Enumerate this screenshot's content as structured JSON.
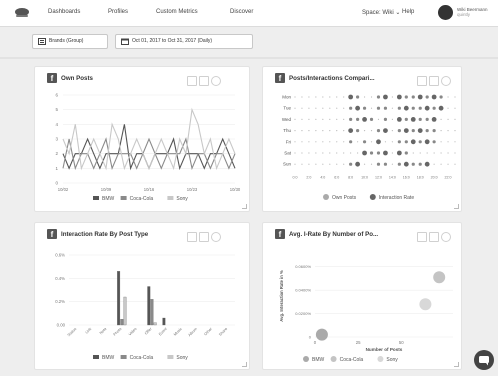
{
  "nav": {
    "items": [
      "Dashboards",
      "Profiles",
      "Custom Metrics",
      "Discover"
    ],
    "space": "Space: Wiki",
    "help": "Help",
    "user_name": "Wiki Beermann",
    "user_sub": "quintly"
  },
  "filters": {
    "profiles_label": "Brands (Group)",
    "date_label": "Oct 01, 2017 to Oct 31, 2017 (Daily)"
  },
  "cards": {
    "own_posts": {
      "title": "Own Posts",
      "legend": [
        "BMW",
        "Coca-Cola",
        "Sony"
      ]
    },
    "posts_interactions": {
      "title": "Posts/Interactions Compari...",
      "legend": [
        "Own Posts",
        "Interaction Rate"
      ]
    },
    "interaction_rate": {
      "title": "Interaction Rate By Post Type",
      "legend": [
        "BMW",
        "Coca-Cola",
        "Sony"
      ]
    },
    "avg_irate": {
      "title": "Avg. I-Rate By Number of Po...",
      "legend": [
        "BMW",
        "Coca-Cola",
        "Sony"
      ]
    }
  },
  "colors": {
    "bmw": "#555555",
    "cocacola": "#8a8a8a",
    "sony": "#c8c8c8"
  },
  "chart_data": [
    {
      "type": "line",
      "title": "Own Posts",
      "x": [
        "10/02",
        "10/03",
        "10/04",
        "10/05",
        "10/06",
        "10/07",
        "10/08",
        "10/09",
        "10/10",
        "10/11",
        "10/12",
        "10/13",
        "10/14",
        "10/15",
        "10/16",
        "10/17",
        "10/18",
        "10/19",
        "10/20",
        "10/21",
        "10/22",
        "10/23",
        "10/24",
        "10/25",
        "10/26",
        "10/27",
        "10/28",
        "10/29",
        "10/30"
      ],
      "x_tick_labels": [
        "10/02",
        "10/09",
        "10/16",
        "10/23",
        "10/30"
      ],
      "ylim": [
        0,
        6
      ],
      "y_ticks": [
        0,
        1,
        2,
        3,
        4,
        5,
        6
      ],
      "series": [
        {
          "name": "BMW",
          "values": [
            2,
            1,
            2,
            2,
            3,
            2,
            1,
            2,
            2,
            2,
            4,
            1,
            2,
            2,
            1,
            2,
            2,
            2,
            3,
            1,
            2,
            2,
            2,
            1,
            2,
            2,
            3,
            2,
            1
          ]
        },
        {
          "name": "Coca-Cola",
          "values": [
            1,
            3,
            1,
            2,
            2,
            1,
            2,
            3,
            1,
            2,
            2,
            2,
            1,
            2,
            3,
            2,
            1,
            2,
            2,
            2,
            3,
            1,
            2,
            2,
            1,
            2,
            2,
            1,
            2
          ]
        },
        {
          "name": "Sony",
          "values": [
            3,
            2,
            4,
            1,
            2,
            3,
            2,
            1,
            4,
            3,
            1,
            2,
            3,
            2,
            1,
            2,
            3,
            2,
            1,
            3,
            2,
            5,
            4,
            2,
            3,
            1,
            2,
            3,
            2
          ]
        }
      ]
    },
    {
      "type": "scatter",
      "title": "Posts/Interactions Comparison",
      "categories": [
        "Mon",
        "Tue",
        "Wed",
        "Thu",
        "Fri",
        "Sat",
        "Sun"
      ],
      "x_tick_labels": [
        "0:0",
        "2:0",
        "4:0",
        "6:0",
        "8:0",
        "10:0",
        "12:0",
        "14:0",
        "16:0",
        "18:0",
        "20:0",
        "22:0"
      ],
      "legend": [
        "Own Posts",
        "Interaction Rate"
      ],
      "marker_hours": [
        [
          8,
          9,
          12,
          13,
          15,
          16,
          17,
          18,
          19,
          20,
          21
        ],
        [
          8,
          9,
          10,
          12,
          13,
          15,
          16,
          17,
          18,
          19,
          20,
          21
        ],
        [
          8,
          9,
          10,
          11,
          13,
          15,
          16,
          17,
          18,
          19,
          20
        ],
        [
          8,
          9,
          12,
          13,
          15,
          16,
          17,
          18,
          19,
          20
        ],
        [
          8,
          10,
          12,
          15,
          16,
          17,
          18,
          19,
          20
        ],
        [
          10,
          11,
          12,
          13,
          15,
          16
        ],
        [
          8,
          9,
          12,
          13,
          15,
          16,
          17,
          18,
          19
        ]
      ]
    },
    {
      "type": "bar",
      "title": "Interaction Rate By Post Type",
      "categories": [
        "Status",
        "Link",
        "Note",
        "Photo",
        "Video",
        "Offer",
        "Event",
        "Music",
        "Album",
        "Other",
        "Share"
      ],
      "ylim": [
        0,
        0.6
      ],
      "y_tick_labels": [
        "0.00",
        "0.2%",
        "0.4%",
        "0.6%"
      ],
      "series": [
        {
          "name": "BMW",
          "values": [
            0,
            0,
            0,
            0.46,
            0,
            0.33,
            0.06,
            0,
            0,
            0,
            0
          ]
        },
        {
          "name": "Coca-Cola",
          "values": [
            0,
            0,
            0,
            0.05,
            0,
            0.22,
            0,
            0,
            0,
            0,
            0
          ]
        },
        {
          "name": "Sony",
          "values": [
            0,
            0,
            0,
            0.24,
            0,
            0.02,
            0,
            0,
            0,
            0,
            0
          ]
        }
      ]
    },
    {
      "type": "scatter",
      "title": "Avg. I-Rate By Number of Posts",
      "xlabel": "Number of Posts",
      "ylabel": "Avg. Interaction Rate in %",
      "xlim": [
        0,
        80
      ],
      "ylim": [
        0,
        0.07
      ],
      "x_tick_labels": [
        "0",
        "25",
        "50"
      ],
      "y_tick_labels": [
        "0",
        "0.0200%",
        "0.0400%",
        "0.0600%"
      ],
      "series": [
        {
          "name": "BMW",
          "points": [
            {
              "x": 4,
              "y": 0.002
            }
          ]
        },
        {
          "name": "Coca-Cola",
          "points": [
            {
              "x": 72,
              "y": 0.051
            }
          ]
        },
        {
          "name": "Sony",
          "points": [
            {
              "x": 64,
              "y": 0.028
            }
          ]
        }
      ]
    }
  ]
}
